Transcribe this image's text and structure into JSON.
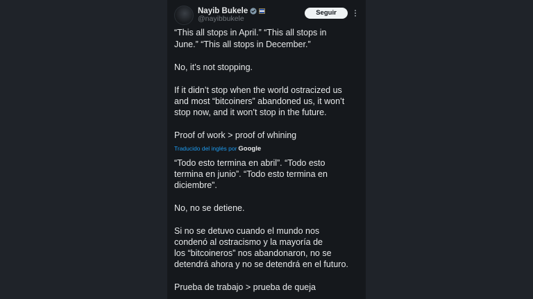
{
  "tweet": {
    "author": {
      "name": "Nayib Bukele",
      "handle": "@nayibbukele",
      "verified_color": "#829aab",
      "flag_icon": "el-salvador-flag-icon"
    },
    "follow_label": "Seguir",
    "more_icon": "more-options-icon",
    "original": {
      "p1_l1": "“This all stops in April.” “This all stops in",
      "p1_l2": "June.” “This all stops in December.”",
      "p2_l1": "No, it’s not stopping.",
      "p3_l1": "If it didn’t stop when the world ostracized us",
      "p3_l2": "and most “bitcoiners” abandoned us, it won’t",
      "p3_l3": "stop now, and it won’t stop in the future.",
      "p4_l1": "Proof of work > proof of whining"
    },
    "translation_label": "Traducido del inglés por",
    "translation_provider": "Google",
    "translated": {
      "p1_l1": "“Todo esto termina en abril”. “Todo esto",
      "p1_l2": "termina en junio”. “Todo esto termina en",
      "p1_l3": "diciembre”.",
      "p2_l1": "No, no se detiene.",
      "p3_l1": "Si no se detuvo cuando el mundo nos",
      "p3_l2": "condenó al ostracismo y la mayoría de",
      "p3_l3": "los “bitcoineros” nos abandonaron, no se",
      "p3_l4": "detendrá ahora y no se detendrá en el futuro.",
      "p4_l1": "Prueba de trabajo > prueba de queja"
    }
  },
  "colors": {
    "background": "#1f2329",
    "panel": "#15181c",
    "text": "#e7e9ea",
    "muted": "#71767b",
    "link": "#1d9bf0"
  }
}
